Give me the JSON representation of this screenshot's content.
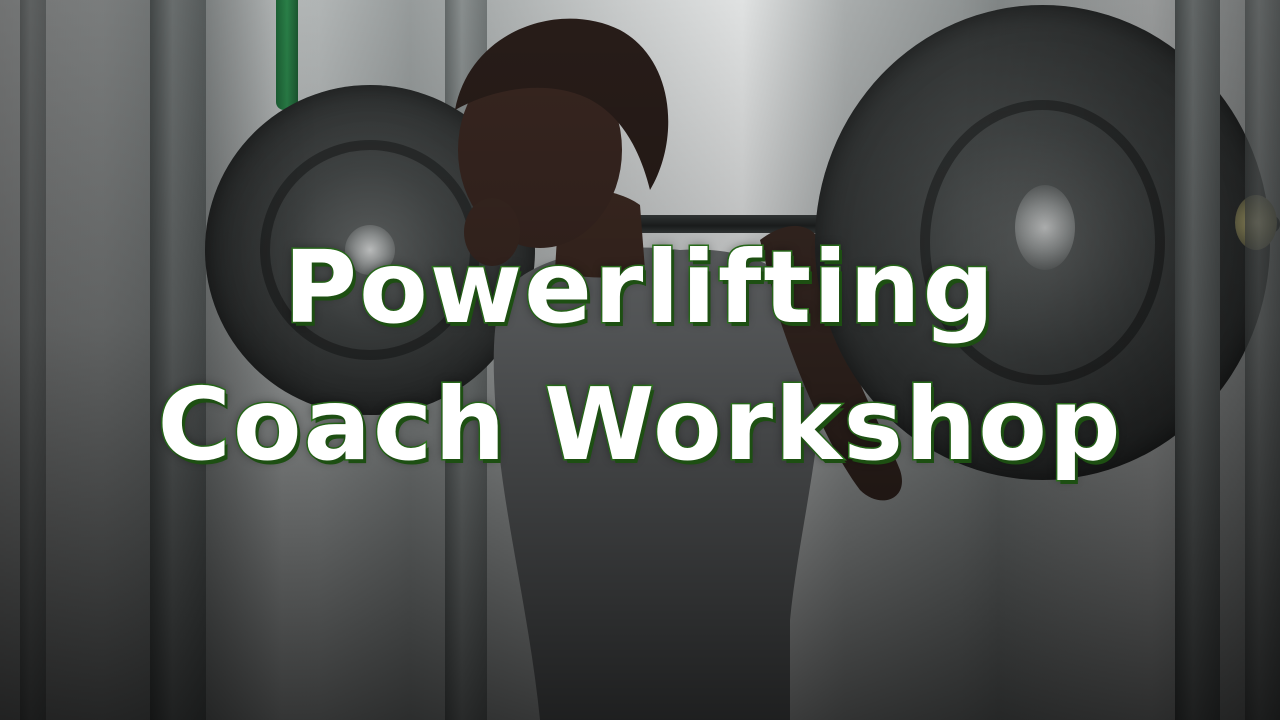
{
  "title": {
    "line1": "Powerlifting",
    "line2": "Coach Workshop"
  },
  "colors": {
    "title_fill": "#ffffff",
    "title_outline": "#2f7d1f"
  },
  "scene": {
    "subject": "athlete-with-barbell",
    "setting": "gym-squat-rack"
  }
}
